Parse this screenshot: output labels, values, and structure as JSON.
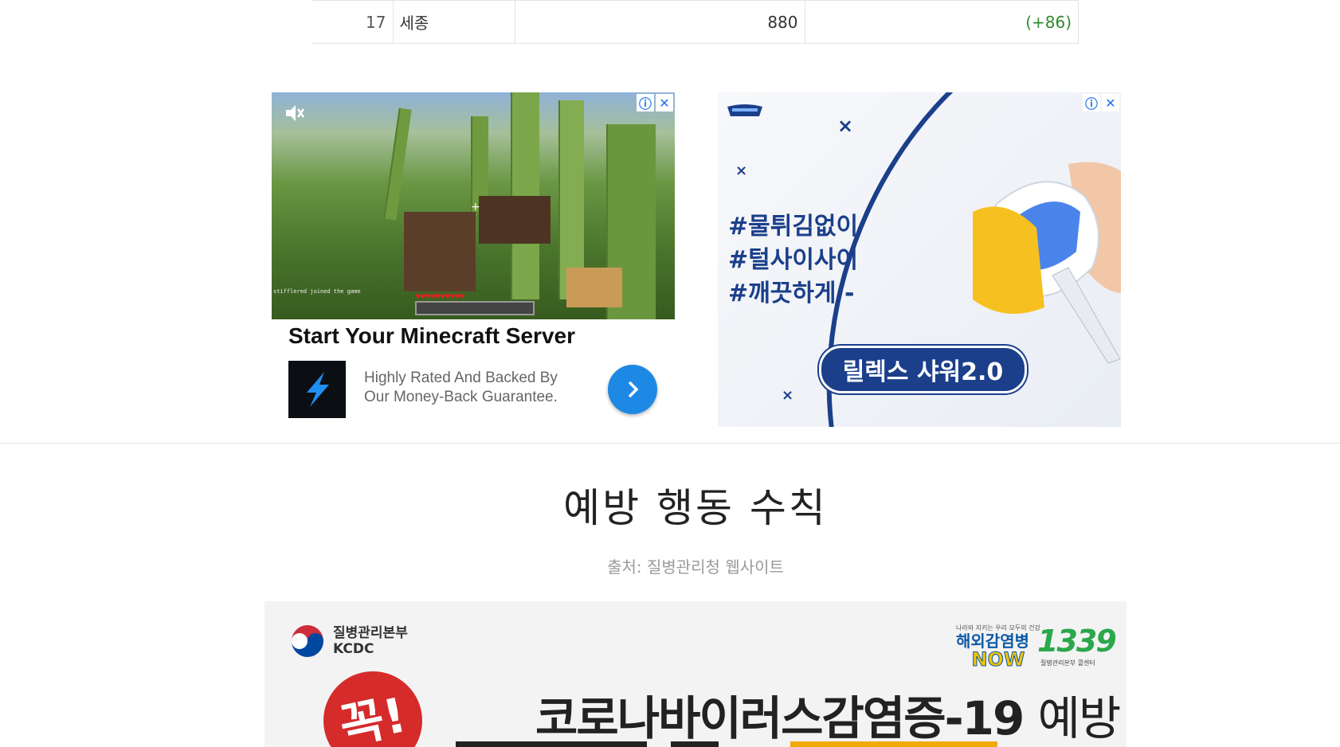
{
  "table": {
    "rows": [
      {
        "rank": "17",
        "region": "세종",
        "total": "880",
        "delta": "(+86)"
      }
    ]
  },
  "ad_left": {
    "title": "Start Your Minecraft Server",
    "description": "Highly Rated And Backed By Our Money-Back Guarantee.",
    "video_chat_text": "stifflered joined the game",
    "icons": [
      "ad-info-icon",
      "ad-close-icon",
      "mute-icon",
      "lightning-icon",
      "chevron-right-icon"
    ]
  },
  "ad_right": {
    "tags": [
      "#물튀김없이",
      "#털사이사이",
      "#깨끗하게 -"
    ],
    "pill_text": "릴렉스 샤워2.0",
    "icons": [
      "ad-info-icon",
      "ad-close-icon",
      "sparkle-icon"
    ]
  },
  "section": {
    "title": "예방 행동 수칙",
    "source": "출처: 질병관리청 웹사이트"
  },
  "poster": {
    "org_name": "질병관리본부",
    "org_abbr": "KCDC",
    "now_top": "나라와 지키는 우리 모두의 건강",
    "now_main": "해외감염병",
    "now_word": "NOW",
    "hotline": "1339",
    "hotline_sub": "질병관리본부 콜센터",
    "stamp": "꼭!",
    "headline": "코로나바이러스감염증-19",
    "headline_suffix": "예방"
  },
  "colors": {
    "delta_green": "#2e8b2e",
    "brand_blue": "#1b3f8a",
    "cta_blue": "#1e88e5",
    "stamp_red": "#d52b2b"
  }
}
